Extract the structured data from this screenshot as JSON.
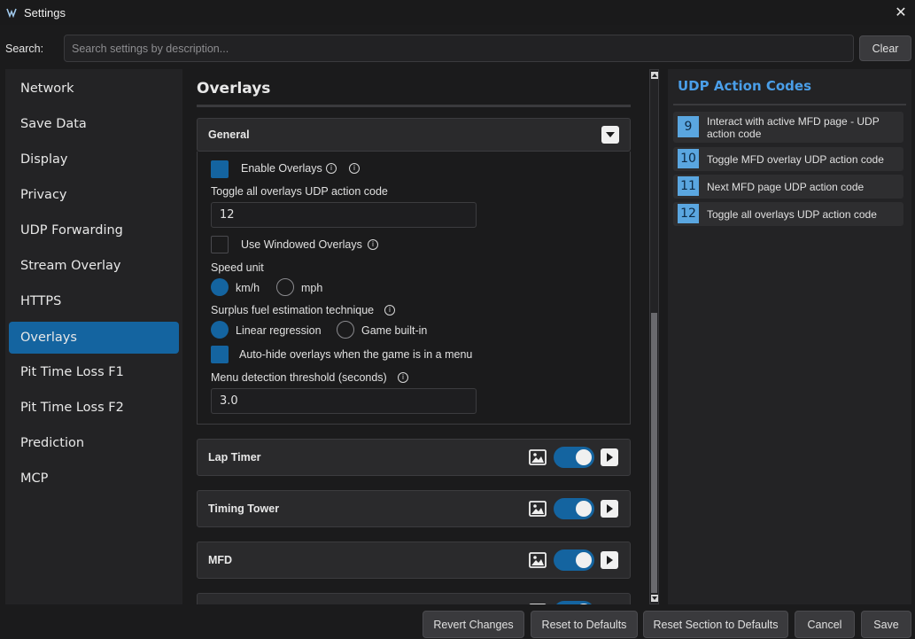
{
  "window": {
    "title": "Settings"
  },
  "search": {
    "label": "Search:",
    "placeholder": "Search settings by description...",
    "value": "",
    "clear_label": "Clear"
  },
  "sidebar": {
    "items": [
      {
        "label": "Network"
      },
      {
        "label": "Save Data"
      },
      {
        "label": "Display"
      },
      {
        "label": "Privacy"
      },
      {
        "label": "UDP Forwarding"
      },
      {
        "label": "Stream Overlay"
      },
      {
        "label": "HTTPS"
      },
      {
        "label": "Overlays",
        "active": true
      },
      {
        "label": "Pit Time Loss F1"
      },
      {
        "label": "Pit Time Loss F2"
      },
      {
        "label": "Prediction"
      },
      {
        "label": "MCP"
      }
    ]
  },
  "main": {
    "title": "Overlays",
    "general": {
      "header": "General",
      "enable_overlays": {
        "label": "Enable Overlays",
        "checked": true
      },
      "toggle_code": {
        "label": "Toggle all overlays UDP action code",
        "value": "12"
      },
      "windowed": {
        "label": "Use Windowed Overlays",
        "checked": false
      },
      "speed_unit": {
        "label": "Speed unit",
        "options": [
          "km/h",
          "mph"
        ],
        "selected": "km/h"
      },
      "fuel_technique": {
        "label": "Surplus fuel estimation technique",
        "options": [
          "Linear regression",
          "Game built-in"
        ],
        "selected": "Linear regression"
      },
      "auto_hide": {
        "label": "Auto-hide overlays when the game is in a menu",
        "checked": true
      },
      "menu_threshold": {
        "label": "Menu detection threshold (seconds)",
        "value": "3.0"
      }
    },
    "overlays": [
      {
        "label": "Lap Timer",
        "enabled": true
      },
      {
        "label": "Timing Tower",
        "enabled": true
      },
      {
        "label": "MFD",
        "enabled": true
      },
      {
        "label": "",
        "enabled": true
      }
    ]
  },
  "udp": {
    "title": "UDP Action Codes",
    "items": [
      {
        "code": "9",
        "text": "Interact with active MFD page - UDP action code"
      },
      {
        "code": "10",
        "text": "Toggle MFD overlay UDP action code"
      },
      {
        "code": "11",
        "text": "Next MFD page UDP action code"
      },
      {
        "code": "12",
        "text": "Toggle all overlays UDP action code"
      }
    ]
  },
  "buttons": {
    "revert": "Revert Changes",
    "reset_defaults": "Reset to Defaults",
    "reset_section": "Reset Section to Defaults",
    "cancel": "Cancel",
    "save": "Save"
  },
  "colors": {
    "accent": "#1464a0",
    "udp_title": "#4a9ee8",
    "badge": "#5aa6e0"
  }
}
